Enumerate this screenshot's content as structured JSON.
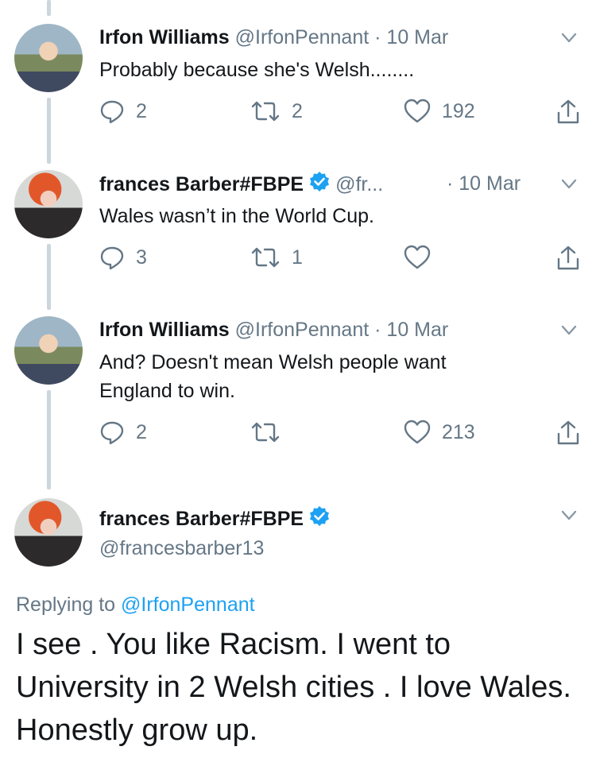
{
  "tweets": [
    {
      "name": "Irfon Williams",
      "handle": "@IrfonPennant",
      "dot": "·",
      "date": "10 Mar",
      "text": "Probably because she's Welsh........",
      "replies": "2",
      "retweets": "2",
      "likes": "192"
    },
    {
      "name": "frances Barber#FBPE",
      "handle": "@fr...",
      "dot": "·",
      "date": "10 Mar",
      "text": "Wales wasn’t in the World Cup.",
      "replies": "3",
      "retweets": "1",
      "likes": ""
    },
    {
      "name": "Irfon Williams",
      "handle": "@IrfonPennant",
      "dot": "·",
      "date": "10 Mar",
      "text": "And? Doesn't mean Welsh people want England to win.",
      "replies": "2",
      "retweets": "",
      "likes": "213"
    }
  ],
  "main_tweet": {
    "name": "frances Barber#FBPE",
    "handle": "@francesbarber13",
    "replying_prefix": "Replying to ",
    "replying_handle": "@IrfonPennant",
    "text": "I see . You like Racism. I went to University in 2 Welsh cities . I love Wales. Honestly grow up."
  },
  "icons": {
    "reply": "reply-icon",
    "retweet": "retweet-icon",
    "like": "heart-icon",
    "share": "share-icon",
    "menu": "chevron-down-icon",
    "verified": "verified-badge-icon"
  },
  "colors": {
    "text": "#14171a",
    "secondary": "#657786",
    "accent": "#1da1f2",
    "thread_line": "#ccd6dd"
  }
}
